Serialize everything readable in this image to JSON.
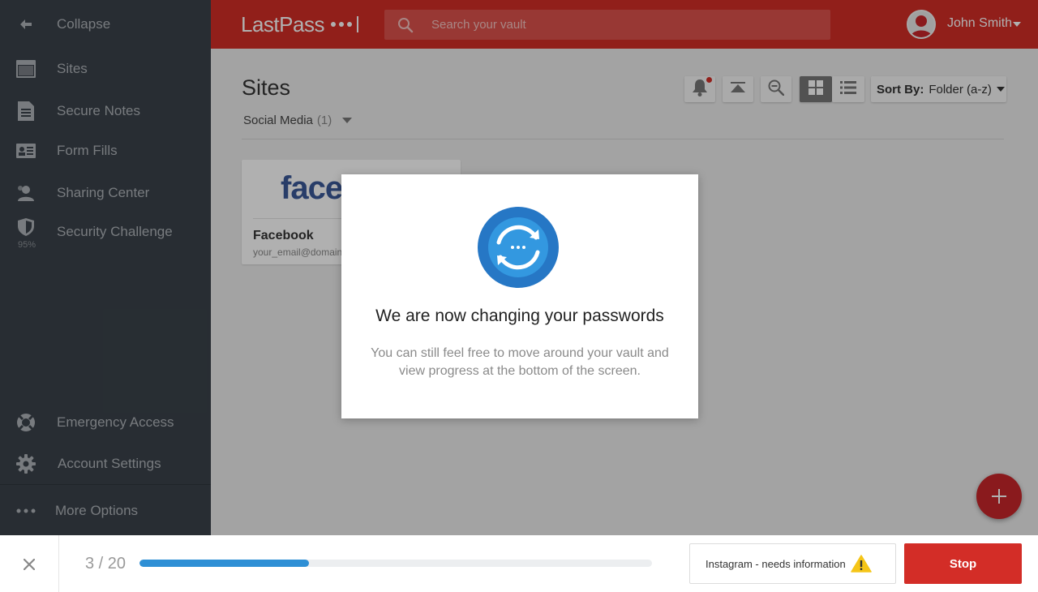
{
  "sidebar": {
    "collapse": {
      "label": "Collapse",
      "icon": "arrow-left-icon"
    },
    "items": [
      {
        "label": "Sites",
        "icon": "browser-window-icon"
      },
      {
        "label": "Secure Notes",
        "icon": "note-icon"
      },
      {
        "label": "Form Fills",
        "icon": "id-card-icon"
      },
      {
        "label": "Sharing Center",
        "icon": "sharing-person-icon"
      },
      {
        "label": "Security Challenge",
        "icon": "shield-icon",
        "sub": "95%"
      }
    ],
    "bottom": [
      {
        "label": "Emergency Access",
        "icon": "lifebuoy-icon"
      },
      {
        "label": "Account Settings",
        "icon": "gear-icon"
      },
      {
        "label": "More Options",
        "icon": "more-dots-icon"
      }
    ]
  },
  "header": {
    "logo_text": "LastPass",
    "search_placeholder": "Search your vault",
    "user_name": "John Smith"
  },
  "main": {
    "title": "Sites",
    "folder": {
      "name": "Social Media",
      "count": "(1)"
    },
    "sort": {
      "label": "Sort By:",
      "value": "Folder (a-z)"
    },
    "cards": [
      {
        "logo_text": "facebook",
        "title": "Facebook",
        "subtitle": "your_email@domain.com"
      }
    ]
  },
  "modal": {
    "title": "We are now changing your passwords",
    "text": "You can still feel free to move around your vault and view progress at the bottom of the screen."
  },
  "footer": {
    "count": "3 / 20",
    "progress": 0.33,
    "notice": "Instagram - needs information",
    "stop_label": "Stop"
  },
  "colors": {
    "brand_red": "#d32d27",
    "sidebar_bg": "#3a424a",
    "progress_blue": "#2e8fd5",
    "warning_yellow": "#f5c518"
  }
}
